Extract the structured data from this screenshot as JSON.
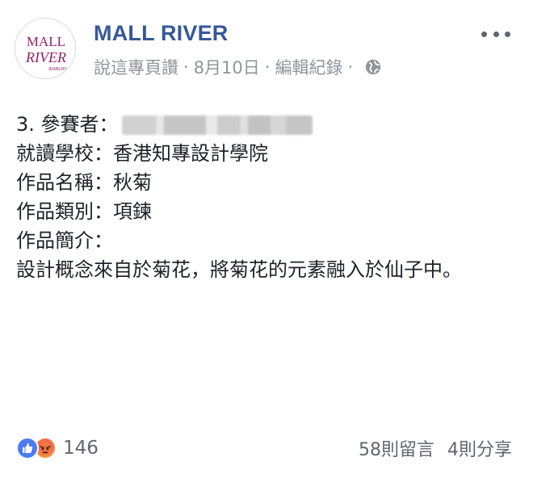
{
  "page": {
    "name": "MALL RIVER",
    "avatar": {
      "line1": "MALL",
      "line2": "RIVER",
      "sub": "JEWELRY",
      "accent": "#8e2270"
    }
  },
  "meta": {
    "author_link": "說這專頁讚",
    "separator": "·",
    "date": "8月10日",
    "edit_history": "編輯紀錄",
    "privacy_icon": "globe-icon"
  },
  "post": {
    "lines": [
      {
        "label": "3. 參賽者：",
        "value": ""
      },
      {
        "label": "就讀學校：",
        "value": "香港知專設計學院"
      },
      {
        "label": "作品名稱：",
        "value": "秋菊"
      },
      {
        "label": "作品類別：",
        "value": "項鍊"
      },
      {
        "label": "作品簡介：",
        "value": ""
      }
    ],
    "description": "設計概念來自於菊花，將菊花的元素融入於仙子中。"
  },
  "footer": {
    "reaction_icons": [
      "like-icon",
      "angry-icon"
    ],
    "reaction_count": "146",
    "comments": "58則留言",
    "shares": "4則分享"
  },
  "colors": {
    "link_blue": "#365899",
    "meta_gray": "#90949c",
    "like_blue": "#4b7bf0",
    "text": "#1d2129"
  }
}
